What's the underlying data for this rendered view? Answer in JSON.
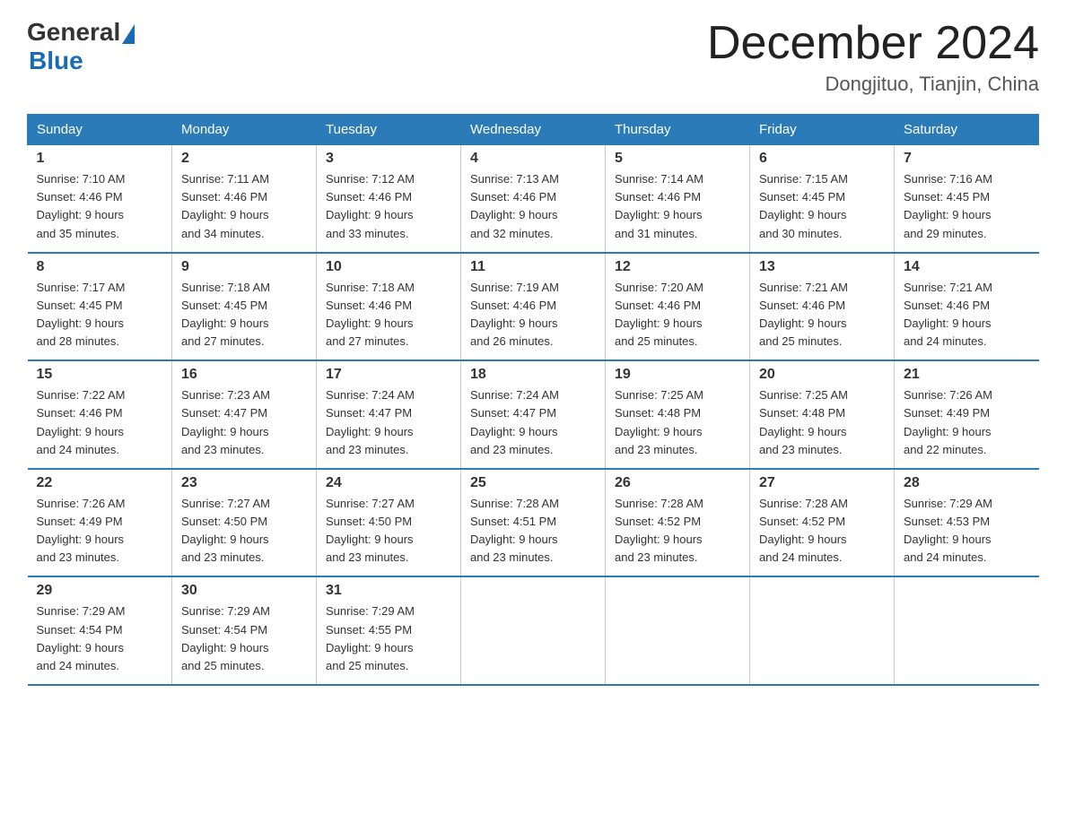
{
  "header": {
    "logo_general": "General",
    "logo_blue": "Blue",
    "title": "December 2024",
    "location": "Dongjituo, Tianjin, China"
  },
  "weekdays": [
    "Sunday",
    "Monday",
    "Tuesday",
    "Wednesday",
    "Thursday",
    "Friday",
    "Saturday"
  ],
  "weeks": [
    [
      {
        "day": "1",
        "sunrise": "7:10 AM",
        "sunset": "4:46 PM",
        "daylight": "9 hours and 35 minutes."
      },
      {
        "day": "2",
        "sunrise": "7:11 AM",
        "sunset": "4:46 PM",
        "daylight": "9 hours and 34 minutes."
      },
      {
        "day": "3",
        "sunrise": "7:12 AM",
        "sunset": "4:46 PM",
        "daylight": "9 hours and 33 minutes."
      },
      {
        "day": "4",
        "sunrise": "7:13 AM",
        "sunset": "4:46 PM",
        "daylight": "9 hours and 32 minutes."
      },
      {
        "day": "5",
        "sunrise": "7:14 AM",
        "sunset": "4:46 PM",
        "daylight": "9 hours and 31 minutes."
      },
      {
        "day": "6",
        "sunrise": "7:15 AM",
        "sunset": "4:45 PM",
        "daylight": "9 hours and 30 minutes."
      },
      {
        "day": "7",
        "sunrise": "7:16 AM",
        "sunset": "4:45 PM",
        "daylight": "9 hours and 29 minutes."
      }
    ],
    [
      {
        "day": "8",
        "sunrise": "7:17 AM",
        "sunset": "4:45 PM",
        "daylight": "9 hours and 28 minutes."
      },
      {
        "day": "9",
        "sunrise": "7:18 AM",
        "sunset": "4:45 PM",
        "daylight": "9 hours and 27 minutes."
      },
      {
        "day": "10",
        "sunrise": "7:18 AM",
        "sunset": "4:46 PM",
        "daylight": "9 hours and 27 minutes."
      },
      {
        "day": "11",
        "sunrise": "7:19 AM",
        "sunset": "4:46 PM",
        "daylight": "9 hours and 26 minutes."
      },
      {
        "day": "12",
        "sunrise": "7:20 AM",
        "sunset": "4:46 PM",
        "daylight": "9 hours and 25 minutes."
      },
      {
        "day": "13",
        "sunrise": "7:21 AM",
        "sunset": "4:46 PM",
        "daylight": "9 hours and 25 minutes."
      },
      {
        "day": "14",
        "sunrise": "7:21 AM",
        "sunset": "4:46 PM",
        "daylight": "9 hours and 24 minutes."
      }
    ],
    [
      {
        "day": "15",
        "sunrise": "7:22 AM",
        "sunset": "4:46 PM",
        "daylight": "9 hours and 24 minutes."
      },
      {
        "day": "16",
        "sunrise": "7:23 AM",
        "sunset": "4:47 PM",
        "daylight": "9 hours and 23 minutes."
      },
      {
        "day": "17",
        "sunrise": "7:24 AM",
        "sunset": "4:47 PM",
        "daylight": "9 hours and 23 minutes."
      },
      {
        "day": "18",
        "sunrise": "7:24 AM",
        "sunset": "4:47 PM",
        "daylight": "9 hours and 23 minutes."
      },
      {
        "day": "19",
        "sunrise": "7:25 AM",
        "sunset": "4:48 PM",
        "daylight": "9 hours and 23 minutes."
      },
      {
        "day": "20",
        "sunrise": "7:25 AM",
        "sunset": "4:48 PM",
        "daylight": "9 hours and 23 minutes."
      },
      {
        "day": "21",
        "sunrise": "7:26 AM",
        "sunset": "4:49 PM",
        "daylight": "9 hours and 22 minutes."
      }
    ],
    [
      {
        "day": "22",
        "sunrise": "7:26 AM",
        "sunset": "4:49 PM",
        "daylight": "9 hours and 23 minutes."
      },
      {
        "day": "23",
        "sunrise": "7:27 AM",
        "sunset": "4:50 PM",
        "daylight": "9 hours and 23 minutes."
      },
      {
        "day": "24",
        "sunrise": "7:27 AM",
        "sunset": "4:50 PM",
        "daylight": "9 hours and 23 minutes."
      },
      {
        "day": "25",
        "sunrise": "7:28 AM",
        "sunset": "4:51 PM",
        "daylight": "9 hours and 23 minutes."
      },
      {
        "day": "26",
        "sunrise": "7:28 AM",
        "sunset": "4:52 PM",
        "daylight": "9 hours and 23 minutes."
      },
      {
        "day": "27",
        "sunrise": "7:28 AM",
        "sunset": "4:52 PM",
        "daylight": "9 hours and 24 minutes."
      },
      {
        "day": "28",
        "sunrise": "7:29 AM",
        "sunset": "4:53 PM",
        "daylight": "9 hours and 24 minutes."
      }
    ],
    [
      {
        "day": "29",
        "sunrise": "7:29 AM",
        "sunset": "4:54 PM",
        "daylight": "9 hours and 24 minutes."
      },
      {
        "day": "30",
        "sunrise": "7:29 AM",
        "sunset": "4:54 PM",
        "daylight": "9 hours and 25 minutes."
      },
      {
        "day": "31",
        "sunrise": "7:29 AM",
        "sunset": "4:55 PM",
        "daylight": "9 hours and 25 minutes."
      },
      null,
      null,
      null,
      null
    ]
  ]
}
